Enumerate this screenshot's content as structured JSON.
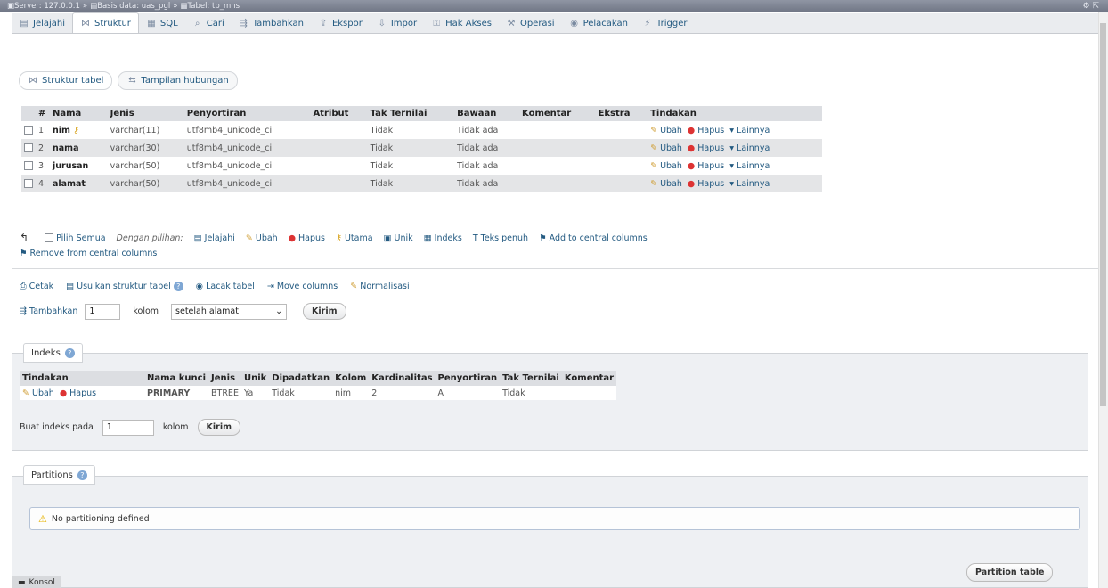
{
  "breadcrumb": {
    "server": "Server: 127.0.0.1",
    "database": "Basis data: uas_pgl",
    "table": "Tabel: tb_mhs"
  },
  "tabs": [
    "Jelajahi",
    "Struktur",
    "SQL",
    "Cari",
    "Tambahkan",
    "Ekspor",
    "Impor",
    "Hak Akses",
    "Operasi",
    "Pelacakan",
    "Trigger"
  ],
  "subtabs": [
    "Struktur tabel",
    "Tampilan hubungan"
  ],
  "structure": {
    "headers": [
      "#",
      "Nama",
      "Jenis",
      "Penyortiran",
      "Atribut",
      "Tak Ternilai",
      "Bawaan",
      "Komentar",
      "Ekstra",
      "Tindakan"
    ],
    "rows": [
      {
        "num": "1",
        "name": "nim",
        "type": "varchar(11)",
        "collation": "utf8mb4_unicode_ci",
        "null": "Tidak",
        "default": "Tidak ada"
      },
      {
        "num": "2",
        "name": "nama",
        "type": "varchar(30)",
        "collation": "utf8mb4_unicode_ci",
        "null": "Tidak",
        "default": "Tidak ada"
      },
      {
        "num": "3",
        "name": "jurusan",
        "type": "varchar(50)",
        "collation": "utf8mb4_unicode_ci",
        "null": "Tidak",
        "default": "Tidak ada"
      },
      {
        "num": "4",
        "name": "alamat",
        "type": "varchar(50)",
        "collation": "utf8mb4_unicode_ci",
        "null": "Tidak",
        "default": "Tidak ada"
      }
    ],
    "actions": {
      "edit": "Ubah",
      "delete": "Hapus",
      "more": "Lainnya"
    }
  },
  "with_selected": {
    "check_all": "Pilih Semua",
    "label": "Dengan pilihan:",
    "actions": [
      "Jelajahi",
      "Ubah",
      "Hapus",
      "Utama",
      "Unik",
      "Indeks",
      "Teks penuh",
      "Add to central columns"
    ],
    "remove": "Remove from central columns"
  },
  "tools": [
    "Cetak",
    "Usulkan struktur tabel",
    "Lacak tabel",
    "Move columns",
    "Normalisasi"
  ],
  "add_columns": {
    "label": "Tambahkan",
    "value": "1",
    "unit": "kolom",
    "position": "setelah alamat",
    "submit": "Kirim"
  },
  "indexes": {
    "legend": "Indeks",
    "headers": [
      "Tindakan",
      "Nama kunci",
      "Jenis",
      "Unik",
      "Dipadatkan",
      "Kolom",
      "Kardinalitas",
      "Penyortiran",
      "Tak Ternilai",
      "Komentar"
    ],
    "row": {
      "edit": "Ubah",
      "delete": "Hapus",
      "key": "PRIMARY",
      "type": "BTREE",
      "unique": "Ya",
      "packed": "Tidak",
      "column": "nim",
      "cardinality": "2",
      "collation": "A",
      "null": "Tidak",
      "comment": ""
    },
    "create": {
      "label": "Buat indeks pada",
      "value": "1",
      "unit": "kolom",
      "submit": "Kirim"
    }
  },
  "partitions": {
    "legend": "Partitions",
    "message": "No partitioning defined!",
    "button": "Partition table"
  },
  "console": "Konsol"
}
